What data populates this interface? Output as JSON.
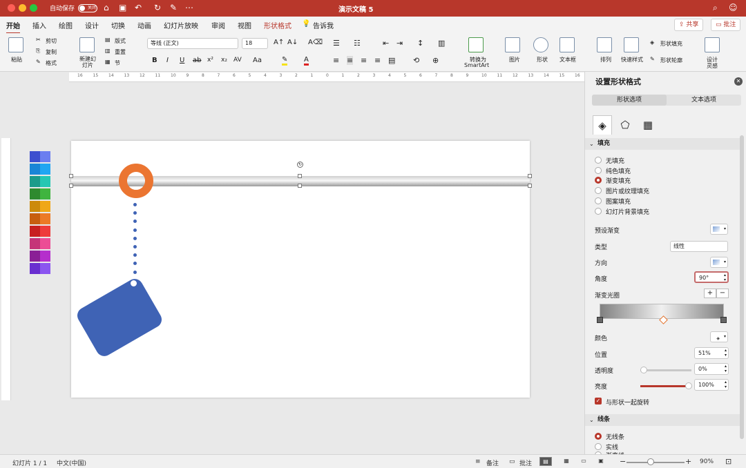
{
  "app": {
    "title": "演示文稿 5",
    "autosave_label": "自动保存",
    "autosave_state": "关闭"
  },
  "tabs": [
    "开始",
    "插入",
    "绘图",
    "设计",
    "切换",
    "动画",
    "幻灯片放映",
    "审阅",
    "视图",
    "形状格式",
    "告诉我"
  ],
  "actions": {
    "share": "共享",
    "comment": "批注"
  },
  "ribbon": {
    "paste": "粘贴",
    "cut": "剪切",
    "copy": "复制",
    "format": "格式",
    "new_slide": "新建幻灯片",
    "layout": "版式",
    "reset": "重置",
    "section": "节",
    "font_name": "等线 (正文)",
    "font_size": "18",
    "to_smartart_1": "转换为",
    "to_smartart_2": "SmartArt",
    "picture": "图片",
    "shape": "形状",
    "textbox": "文本框",
    "arrange": "排列",
    "quick_styles": "快速样式",
    "shape_fill": "形状填充",
    "shape_outline": "形状轮廓",
    "design_ideas_1": "设计",
    "design_ideas_2": "灵感"
  },
  "ruler_labels": [
    "16",
    "15",
    "14",
    "13",
    "12",
    "11",
    "10",
    "9",
    "8",
    "7",
    "6",
    "5",
    "4",
    "3",
    "2",
    "1",
    "0",
    "1",
    "2",
    "3",
    "4",
    "5",
    "6",
    "7",
    "8",
    "9",
    "10",
    "11",
    "12",
    "13",
    "14",
    "15",
    "16"
  ],
  "swatches": [
    [
      "#3d4fcf",
      "#6b7ef0"
    ],
    [
      "#1a85d6",
      "#20a6f2"
    ],
    [
      "#1c9b8a",
      "#25c7b2"
    ],
    [
      "#2f8a2f",
      "#3fb43f"
    ],
    [
      "#cc8a0c",
      "#f0a718"
    ],
    [
      "#c75e10",
      "#ec7a26"
    ],
    [
      "#c72020",
      "#ee3b3b"
    ],
    [
      "#c53478",
      "#ec4d95"
    ],
    [
      "#8a1f96",
      "#b52fcc"
    ],
    [
      "#6a2fd0",
      "#8b55f0"
    ]
  ],
  "pane": {
    "title": "设置形状格式",
    "tab_shape": "形状选项",
    "tab_text": "文本选项",
    "fill_section": "填充",
    "fill_options": [
      "无填充",
      "纯色填充",
      "渐变填充",
      "图片或纹理填充",
      "图案填充",
      "幻灯片背景填充"
    ],
    "fill_selected": 2,
    "preset_label": "预设渐变",
    "type_label": "类型",
    "type_value": "线性",
    "direction_label": "方向",
    "angle_label": "角度",
    "angle_value": "90°",
    "stops_label": "渐变光圈",
    "color_label": "颜色",
    "position_label": "位置",
    "position_value": "51%",
    "transparency_label": "透明度",
    "transparency_value": "0%",
    "brightness_label": "亮度",
    "brightness_value": "100%",
    "rotate_with_shape": "与形状一起旋转",
    "line_section": "线条",
    "line_options": [
      "无线条",
      "实线",
      "渐变线"
    ]
  },
  "status": {
    "slide": "幻灯片 1 / 1",
    "language": "中文(中国)",
    "notes": "备注",
    "comments": "批注",
    "zoom": "90%"
  }
}
